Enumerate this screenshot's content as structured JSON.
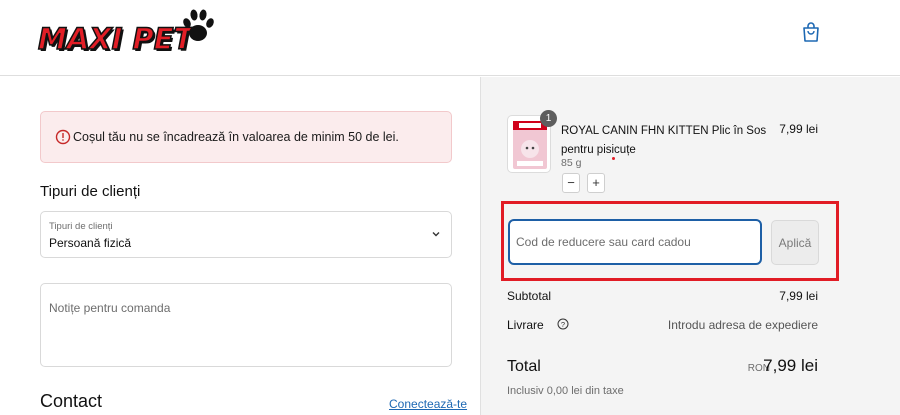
{
  "brand": {
    "logo_text": "MAXI PET",
    "accent_color": "#e21e26"
  },
  "header": {
    "cart_icon": "shopping-bag-icon"
  },
  "alert": {
    "icon": "alert-circle-icon",
    "text": "Coșul tău nu se încadrează în valoarea de minim 50 de lei."
  },
  "client_type": {
    "title": "Tipuri de clienți",
    "field_label": "Tipuri de clienți",
    "selected": "Persoană fizică"
  },
  "notes": {
    "placeholder": "Notițe pentru comanda"
  },
  "contact": {
    "title": "Contact",
    "login_link": "Conectează-te"
  },
  "cart": {
    "items": [
      {
        "quantity": "1",
        "name": "ROYAL CANIN FHN KITTEN Plic în Sos pentru pisicuțe",
        "weight": "85 g",
        "price": "7,99 lei"
      }
    ],
    "minus_label": "−",
    "plus_label": "+"
  },
  "discount": {
    "placeholder": "Cod de reducere sau card cadou",
    "apply_label": "Aplică",
    "highlight_color": "#e11c25"
  },
  "summary": {
    "subtotal_label": "Subtotal",
    "subtotal_value": "7,99 lei",
    "shipping_label": "Livrare",
    "shipping_value": "Introdu adresa de expediere",
    "total_label": "Total",
    "currency": "RON",
    "total_value": "7,99 lei",
    "tax_note": "Inclusiv 0,00 lei din taxe"
  }
}
